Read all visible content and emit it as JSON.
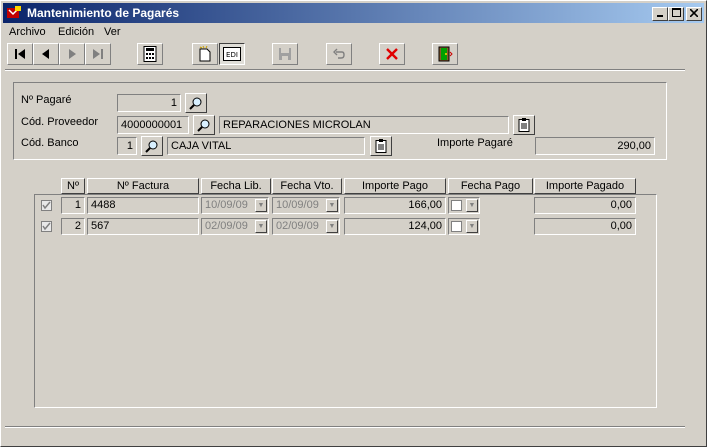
{
  "window": {
    "title": "Mantenimiento de Pagarés"
  },
  "menu": [
    {
      "label": "Archivo"
    },
    {
      "label": "Edición"
    },
    {
      "label": "Ver"
    }
  ],
  "toolbar": {
    "icons": [
      "first-record-icon",
      "previous-record-icon",
      "next-record-icon",
      "last-record-icon",
      "calculator-icon",
      "new-record-icon",
      "edit-record-icon",
      "save-icon",
      "undo-icon",
      "delete-icon",
      "exit-icon"
    ]
  },
  "header": {
    "pagare_label": "Nº Pagaré",
    "pagare_value": "1",
    "proveedor_label": "Cód. Proveedor",
    "proveedor_code": "4000000001",
    "proveedor_name": "REPARACIONES MICROLAN",
    "banco_label": "Cód. Banco",
    "banco_code": "1",
    "banco_name": "CAJA VITAL",
    "importe_label": "Importe Pagaré",
    "importe_value": "290,00"
  },
  "table": {
    "columns": [
      "Nº",
      "Nº Factura",
      "Fecha Lib.",
      "Fecha Vto.",
      "Importe Pago",
      "Fecha Pago",
      "Importe Pagado"
    ],
    "rows": [
      {
        "n": "1",
        "factura": "4488",
        "fecha_lib": "10/09/09",
        "fecha_vto": "10/09/09",
        "importe_pago": "166,00",
        "importe_pagado": "0,00",
        "checked": true
      },
      {
        "n": "2",
        "factura": "567",
        "fecha_lib": "02/09/09",
        "fecha_vto": "02/09/09",
        "importe_pago": "124,00",
        "importe_pagado": "0,00",
        "checked": true
      }
    ]
  }
}
